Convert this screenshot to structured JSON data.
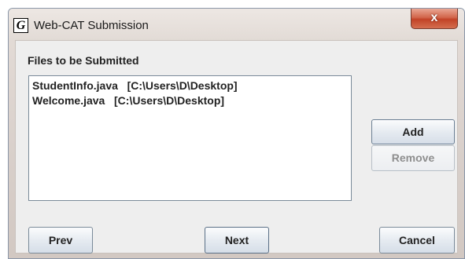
{
  "window": {
    "title": "Web-CAT Submission",
    "app_icon_glyph": "G",
    "close_glyph": "x"
  },
  "content": {
    "section_label": "Files to be Submitted",
    "files": [
      "StudentInfo.java   [C:\\Users\\D\\Desktop]",
      "Welcome.java   [C:\\Users\\D\\Desktop]"
    ]
  },
  "buttons": {
    "add": "Add",
    "remove": "Remove",
    "prev": "Prev",
    "next": "Next",
    "cancel": "Cancel"
  },
  "state": {
    "remove_enabled": false
  },
  "colors": {
    "close_button": "#c24327",
    "disabled_text": "#8e8e8e"
  },
  "icons": {
    "app": "web-cat-g-icon",
    "close": "close-icon"
  }
}
